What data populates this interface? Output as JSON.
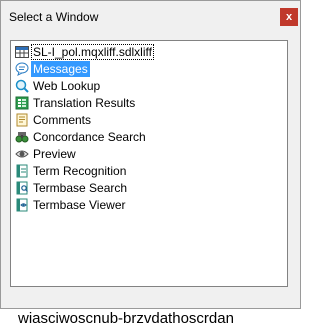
{
  "window": {
    "title": "Select a Window",
    "close_label": "x"
  },
  "list": {
    "selected_index": 1,
    "items": [
      {
        "label": "SL-I_pol.mqxliff.sdlxliff",
        "icon": "document-grid-icon"
      },
      {
        "label": "Messages",
        "icon": "messages-icon"
      },
      {
        "label": "Web Lookup",
        "icon": "web-lookup-icon"
      },
      {
        "label": "Translation Results",
        "icon": "translation-results-icon"
      },
      {
        "label": "Comments",
        "icon": "comments-icon"
      },
      {
        "label": "Concordance Search",
        "icon": "concordance-search-icon"
      },
      {
        "label": "Preview",
        "icon": "preview-eye-icon"
      },
      {
        "label": "Term Recognition",
        "icon": "term-recognition-icon"
      },
      {
        "label": "Termbase Search",
        "icon": "termbase-search-icon"
      },
      {
        "label": "Termbase Viewer",
        "icon": "termbase-viewer-icon"
      }
    ]
  },
  "background_text": "wiasciwoscnub-brzvdathoscrdan"
}
